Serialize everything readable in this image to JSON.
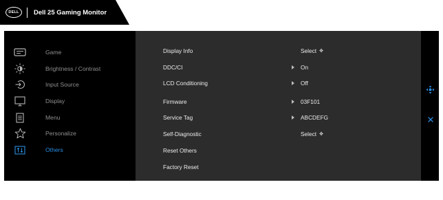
{
  "header": {
    "logo_text": "DELL",
    "title": "Dell 25 Gaming Monitor"
  },
  "menu": {
    "items": [
      {
        "label": "Game",
        "icon": "game-icon"
      },
      {
        "label": "Brightness / Contrast",
        "icon": "brightness-icon"
      },
      {
        "label": "Input Source",
        "icon": "input-source-icon"
      },
      {
        "label": "Display",
        "icon": "display-icon"
      },
      {
        "label": "Menu",
        "icon": "menu-list-icon"
      },
      {
        "label": "Personalize",
        "icon": "star-icon"
      },
      {
        "label": "Others",
        "icon": "others-icon",
        "active": true
      }
    ]
  },
  "others": {
    "rows": [
      {
        "label": "Display Info",
        "value": "Select"
      },
      {
        "label": "DDC/CI",
        "value": "On"
      },
      {
        "label": "LCD Conditioning",
        "value": "Off"
      },
      {
        "label": "Firmware",
        "value": "03F101"
      },
      {
        "label": "Service Tag",
        "value": "ABCDEFG"
      },
      {
        "label": "Self-Diagnostic",
        "value": "Select"
      },
      {
        "label": "Reset Others",
        "value": ""
      },
      {
        "label": "Factory Reset",
        "value": ""
      }
    ]
  },
  "nav": {
    "move_icon": "joystick-move-icon",
    "exit_icon": "close-icon"
  },
  "colors": {
    "accent": "#2a8de0",
    "panel": "#000000",
    "submenu": "#2c2c2c"
  }
}
